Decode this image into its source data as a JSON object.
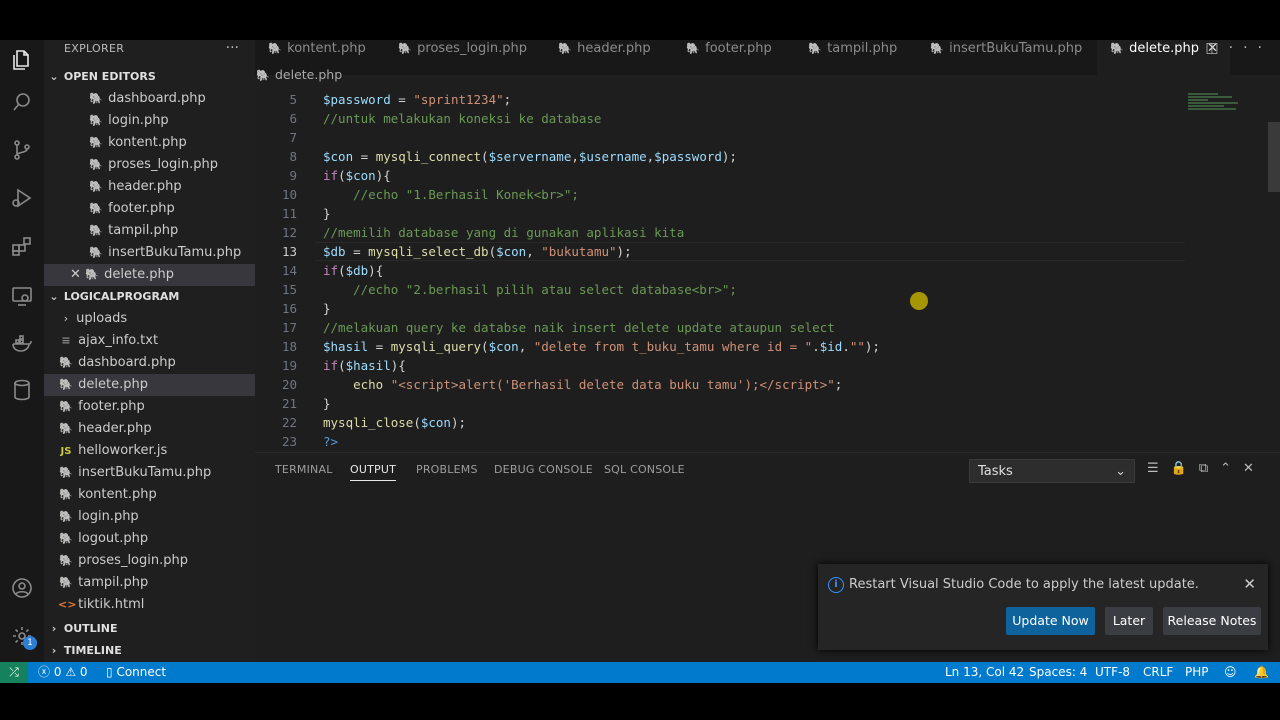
{
  "sidebar": {
    "title": "EXPLORER",
    "more": "···",
    "open_editors_label": "OPEN EDITORS",
    "open_editors": [
      "dashboard.php",
      "login.php",
      "kontent.php",
      "proses_login.php",
      "header.php",
      "footer.php",
      "tampil.php",
      "insertBukuTamu.php",
      "delete.php"
    ],
    "project_label": "LOGICALPROGRAM",
    "folders": [
      "uploads"
    ],
    "files": [
      {
        "name": "ajax_info.txt",
        "icon": "txt"
      },
      {
        "name": "dashboard.php",
        "icon": "php"
      },
      {
        "name": "delete.php",
        "icon": "php"
      },
      {
        "name": "footer.php",
        "icon": "php"
      },
      {
        "name": "header.php",
        "icon": "php"
      },
      {
        "name": "helloworker.js",
        "icon": "js"
      },
      {
        "name": "insertBukuTamu.php",
        "icon": "php"
      },
      {
        "name": "kontent.php",
        "icon": "php"
      },
      {
        "name": "login.php",
        "icon": "php"
      },
      {
        "name": "logout.php",
        "icon": "php"
      },
      {
        "name": "proses_login.php",
        "icon": "php"
      },
      {
        "name": "tampil.php",
        "icon": "php"
      },
      {
        "name": "tiktik.html",
        "icon": "html"
      }
    ],
    "outline_label": "OUTLINE",
    "timeline_label": "TIMELINE"
  },
  "tabs": [
    "kontent.php",
    "proses_login.php",
    "header.php",
    "footer.php",
    "tampil.php",
    "insertBukuTamu.php",
    "delete.php"
  ],
  "active_tab": "delete.php",
  "breadcrumb": "delete.php",
  "editor": {
    "line_numbers": [
      "5",
      "6",
      "7",
      "8",
      "9",
      "10",
      "11",
      "12",
      "13",
      "14",
      "15",
      "16",
      "17",
      "18",
      "19",
      "20",
      "21",
      "22",
      "23"
    ],
    "current_line": "13"
  },
  "panel": {
    "tabs": [
      "TERMINAL",
      "OUTPUT",
      "PROBLEMS",
      "DEBUG CONSOLE",
      "SQL CONSOLE"
    ],
    "active": "OUTPUT",
    "dropdown": "Tasks"
  },
  "notification": {
    "message": "Restart Visual Studio Code to apply the latest update.",
    "update_now": "Update Now",
    "later": "Later",
    "release_notes": "Release Notes"
  },
  "status": {
    "errors": "0",
    "warnings": "0",
    "connect": "Connect",
    "position": "Ln 13, Col 42",
    "spaces": "Spaces: 4",
    "encoding": "UTF-8",
    "eol": "CRLF",
    "language": "PHP"
  },
  "activity_badge": "1"
}
